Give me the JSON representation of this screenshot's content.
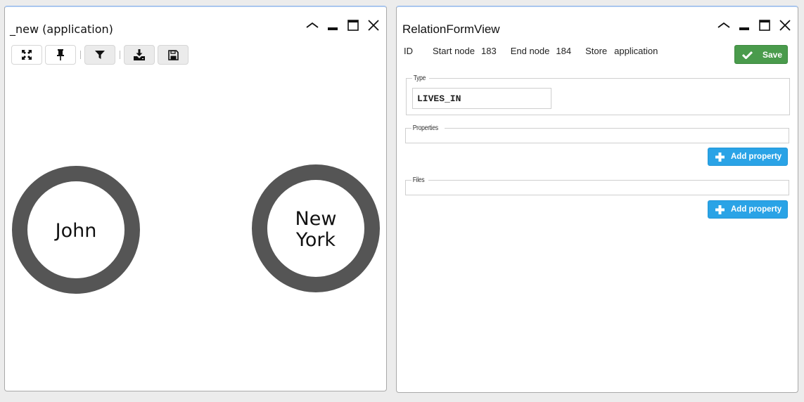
{
  "graph_window": {
    "title": "_new (application)",
    "controls": [
      "collapse",
      "minimize",
      "maximize",
      "close"
    ],
    "toolbar": [
      {
        "name": "fit-graph",
        "icon": "expand-arrows-icon",
        "style": "white"
      },
      {
        "name": "pin",
        "icon": "pin-icon",
        "style": "white"
      },
      {
        "name": "filter",
        "icon": "filter-icon",
        "style": "grey"
      },
      {
        "name": "download",
        "icon": "download-icon",
        "style": "grey"
      },
      {
        "name": "save",
        "icon": "floppy-disk-icon",
        "style": "grey"
      }
    ],
    "nodes": [
      {
        "id": "john",
        "label_lines": [
          "John"
        ]
      },
      {
        "id": "new-york",
        "label_lines": [
          "New",
          "York"
        ]
      }
    ],
    "node_color": "#555555"
  },
  "form_window": {
    "title": "RelationFormView",
    "meta": {
      "id_label": "ID",
      "id_value": "",
      "start_label": "Start node",
      "start_value": "183",
      "end_label": "End node",
      "end_value": "184",
      "store_label": "Store",
      "store_value": "application"
    },
    "save_label": "Save",
    "type_legend": "Type",
    "type_value": "LIVES_IN",
    "properties_legend": "Properties",
    "files_legend": "Files",
    "add_property_label": "Add property",
    "colors": {
      "save": "#4a9b4c",
      "add": "#2aa3e6"
    }
  }
}
